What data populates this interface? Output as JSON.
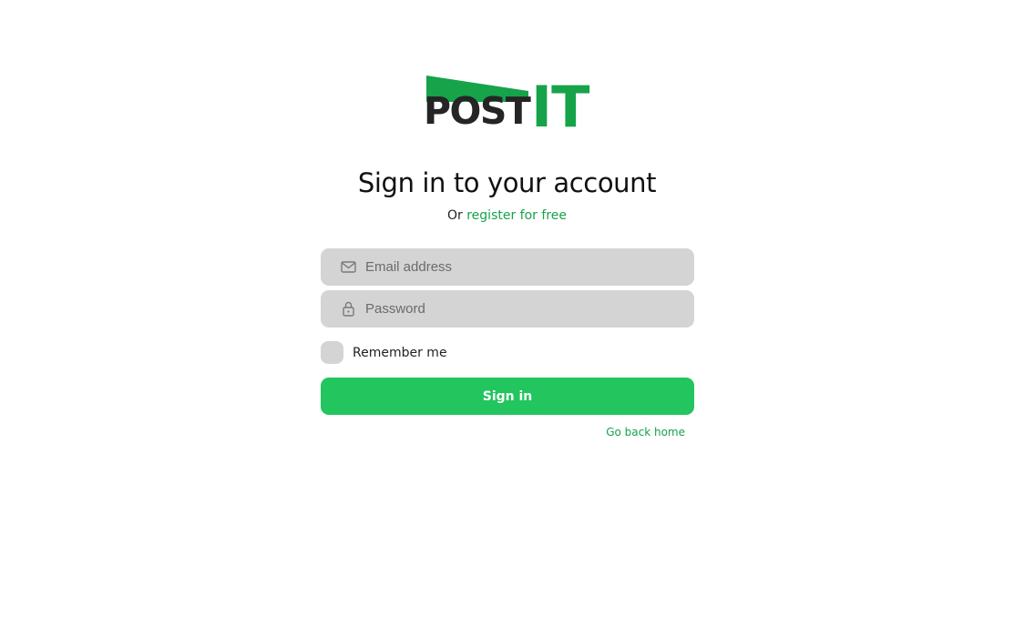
{
  "logo": {
    "text_post": "POST",
    "text_it": "IT",
    "accent_color": "#16a34a",
    "dark_color": "#252525"
  },
  "heading": {
    "title": "Sign in to your account",
    "subtitle_prefix": "Or",
    "register_link": "register for free"
  },
  "form": {
    "email_placeholder": "Email address",
    "email_icon": "mail-icon",
    "password_placeholder": "Password",
    "password_icon": "lock-icon",
    "remember_label": "Remember me",
    "submit_label": "Sign in",
    "go_home_link": "Go back home"
  },
  "colors": {
    "primary": "#22c55e",
    "link": "#16a34a",
    "field_bg": "#d4d4d4"
  }
}
